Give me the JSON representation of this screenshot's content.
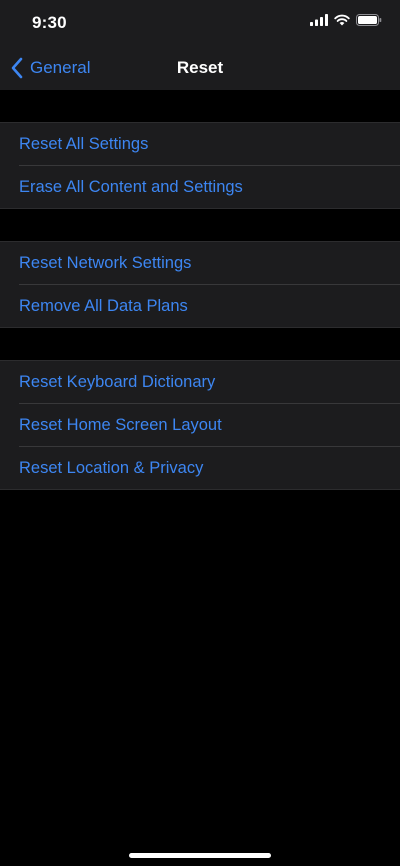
{
  "status_bar": {
    "time": "9:30",
    "icons": [
      "cellular-signal-icon",
      "wifi-icon",
      "battery-icon"
    ]
  },
  "nav": {
    "back_label": "General",
    "title": "Reset"
  },
  "groups": [
    {
      "items": [
        {
          "label": "Reset All Settings"
        },
        {
          "label": "Erase All Content and Settings"
        }
      ]
    },
    {
      "items": [
        {
          "label": "Reset Network Settings"
        },
        {
          "label": "Remove All Data Plans"
        }
      ]
    },
    {
      "items": [
        {
          "label": "Reset Keyboard Dictionary"
        },
        {
          "label": "Reset Home Screen Layout"
        },
        {
          "label": "Reset Location & Privacy"
        }
      ]
    }
  ],
  "colors": {
    "accent": "#3d86f2",
    "background": "#000000",
    "cell_background": "#1c1c1e",
    "separator": "#38383a"
  }
}
